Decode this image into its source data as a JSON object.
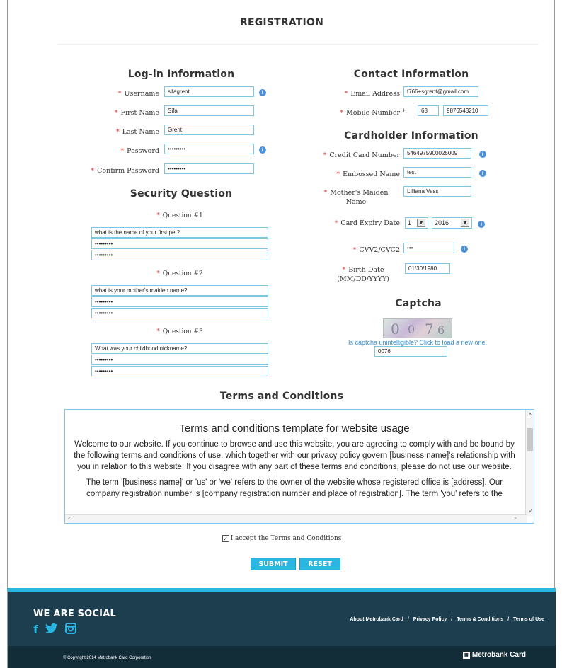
{
  "page_title": "REGISTRATION",
  "login": {
    "heading": "Log-in Information",
    "username": {
      "label": "Username",
      "value": "sifagrent"
    },
    "first_name": {
      "label": "First Name",
      "value": "Sifa"
    },
    "last_name": {
      "label": "Last Name",
      "value": "Grent"
    },
    "password": {
      "label": "Password",
      "value": "•••••••••"
    },
    "confirm_password": {
      "label": "Confirm Password",
      "value": "•••••••••"
    }
  },
  "security": {
    "heading": "Security Question",
    "questions": [
      {
        "label": "Question #1",
        "question": "what is the name of your first pet?",
        "answer": "•••••••••",
        "confirm": "•••••••••"
      },
      {
        "label": "Question #2",
        "question": "what is your mother's maiden name?",
        "answer": "•••••••••",
        "confirm": "•••••••••"
      },
      {
        "label": "Question #3",
        "question": "What was your childhood nickname?",
        "answer": "•••••••••",
        "confirm": "•••••••••"
      }
    ]
  },
  "contact": {
    "heading": "Contact Information",
    "email": {
      "label": "Email Address",
      "value": "t766+sgrent@gmail.com"
    },
    "mobile": {
      "label": "Mobile Number",
      "plus": "+",
      "code": "63",
      "value": "9876543210"
    }
  },
  "cardholder": {
    "heading": "Cardholder Information",
    "credit_card": {
      "label": "Credit Card Number",
      "value": "5464975900025009"
    },
    "embossed": {
      "label": "Embossed Name",
      "value": "test"
    },
    "maiden": {
      "label_line1": "Mother's Maiden",
      "label_line2": "Name",
      "value": "Lilliana Vess"
    },
    "expiry": {
      "label": "Card Expiry Date",
      "month": "1",
      "year": "2016"
    },
    "cvv": {
      "label": "CVV2/CVC2",
      "value": "•••"
    },
    "birth": {
      "label_line1": "Birth Date",
      "label_line2": "(MM/DD/YYYY)",
      "value": "01/30/1980"
    }
  },
  "captcha": {
    "heading": "Captcha",
    "link": "Is captcha unintelligible? Click to load a new one.",
    "value": "0076"
  },
  "terms": {
    "heading": "Terms and Conditions",
    "box_title": "Terms and conditions template for website usage",
    "para1": "Welcome to our website. If you continue to browse and use this website, you are agreeing to comply with and be bound by the following terms and conditions of use, which together with our privacy policy govern [business name]'s relationship with you in relation to this website. If you disagree with any part of these terms and conditions, please do not use our website.",
    "para2": "The term '[business name]' or 'us' or 'we' refers to the owner of the website whose registered office is [address]. Our company registration number is [company registration number and place of registration]. The term 'you' refers to the",
    "accept_label": "I accept the Terms and Conditions"
  },
  "buttons": {
    "submit": "SUBMIT",
    "reset": "RESET"
  },
  "footer": {
    "social_heading": "WE ARE SOCIAL",
    "links": [
      "About Metrobank Card",
      "Privacy Policy",
      "Terms & Conditions",
      "Terms of Use"
    ],
    "separator": "/",
    "copyright": "© Copyright 2014 Metrobank Card Corporation",
    "logo": "Metrobank Card"
  },
  "colors": {
    "accent": "#29b6e2",
    "footer": "#1c3e4f",
    "required": "#e0322e",
    "field_border": "#7fc6e3"
  }
}
